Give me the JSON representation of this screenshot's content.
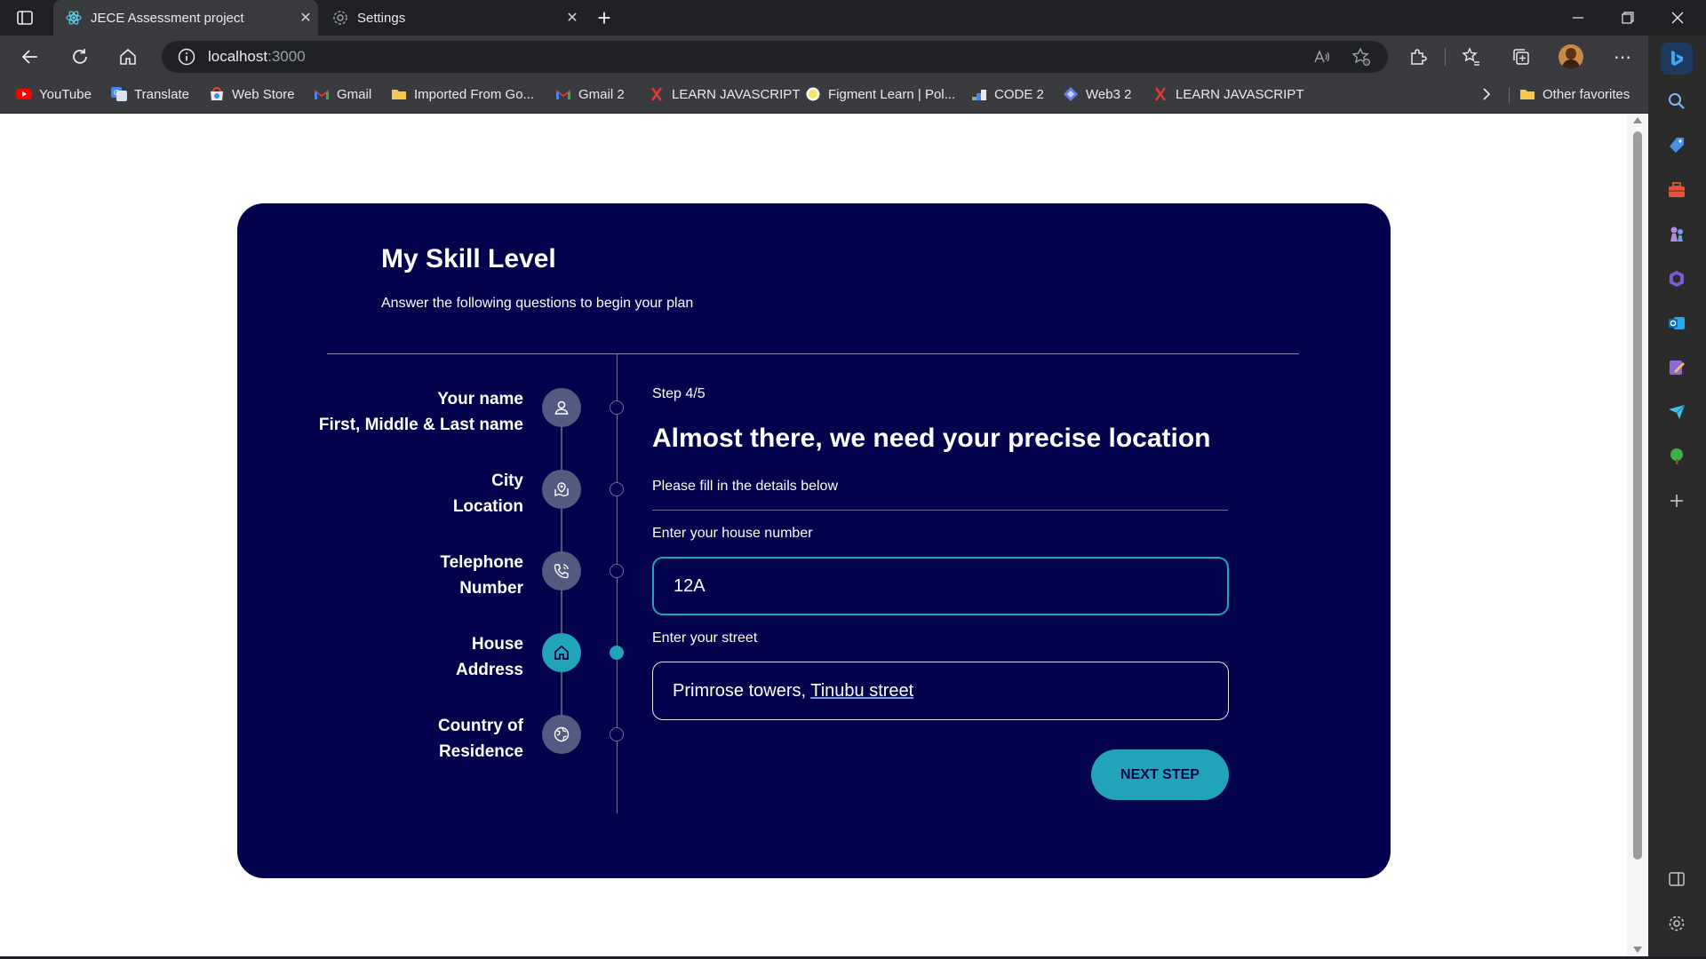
{
  "browser": {
    "tabs": [
      {
        "label": "JECE Assessment project",
        "icon": "react-icon",
        "active": true
      },
      {
        "label": "Settings",
        "icon": "gear-icon",
        "active": false
      }
    ],
    "new_tab_symbol": "+",
    "close_symbol": "✕",
    "url_host": "localhost",
    "url_port": ":3000",
    "favorites": [
      {
        "label": "YouTube",
        "icon": "youtube-icon",
        "color": "#ff0000"
      },
      {
        "label": "Translate",
        "icon": "translate-icon",
        "color": "#4285f4"
      },
      {
        "label": "Web Store",
        "icon": "webstore-icon",
        "color": "#ea4335"
      },
      {
        "label": "Gmail",
        "icon": "gmail-icon",
        "color": "#ea4335"
      },
      {
        "label": "Imported From Go...",
        "icon": "folder-icon",
        "color": "#f2c94c"
      },
      {
        "label": "Gmail 2",
        "icon": "gmail-icon",
        "color": "#ea4335"
      },
      {
        "label": "LEARN JAVASCRIPT",
        "icon": "x-icon",
        "color": "#e53935"
      },
      {
        "label": "Figment Learn | Pol...",
        "icon": "figment-icon",
        "color": "#f5e663"
      },
      {
        "label": "CODE 2",
        "icon": "code-icon",
        "color": "#9aa0a6"
      },
      {
        "label": "Web3 2",
        "icon": "web3-icon",
        "color": "#627eea"
      },
      {
        "label": "LEARN JAVASCRIPT",
        "icon": "x-icon",
        "color": "#e53935"
      }
    ],
    "other_favorites": "Other favorites"
  },
  "card": {
    "title": "My Skill Level",
    "subtitle": "Answer the following questions to begin your plan"
  },
  "steps": [
    {
      "line1": "Your name",
      "line2": "First, Middle & Last name",
      "icon": "user-icon",
      "active": false
    },
    {
      "line1": "City",
      "line2": "Location",
      "icon": "map-pin-icon",
      "active": false
    },
    {
      "line1": "Telephone",
      "line2": "Number",
      "icon": "phone-icon",
      "active": false
    },
    {
      "line1": "House",
      "line2": "Address",
      "icon": "home-icon",
      "active": true
    },
    {
      "line1": "Country of",
      "line2": "Residence",
      "icon": "globe-icon",
      "active": false
    }
  ],
  "form": {
    "step_indicator": "Step 4/5",
    "heading": "Almost there, we need your precise location",
    "description": "Please fill in the details below",
    "house_label": "Enter your house number",
    "house_value": "12A",
    "street_label": "Enter your street",
    "street_value_part1": "Primrose towers, ",
    "street_value_part2": "Tinubu street",
    "next_button": "NEXT STEP"
  },
  "colors": {
    "card_bg": "#03024c",
    "accent": "#21a3b8",
    "inactive_step": "#545b80"
  }
}
